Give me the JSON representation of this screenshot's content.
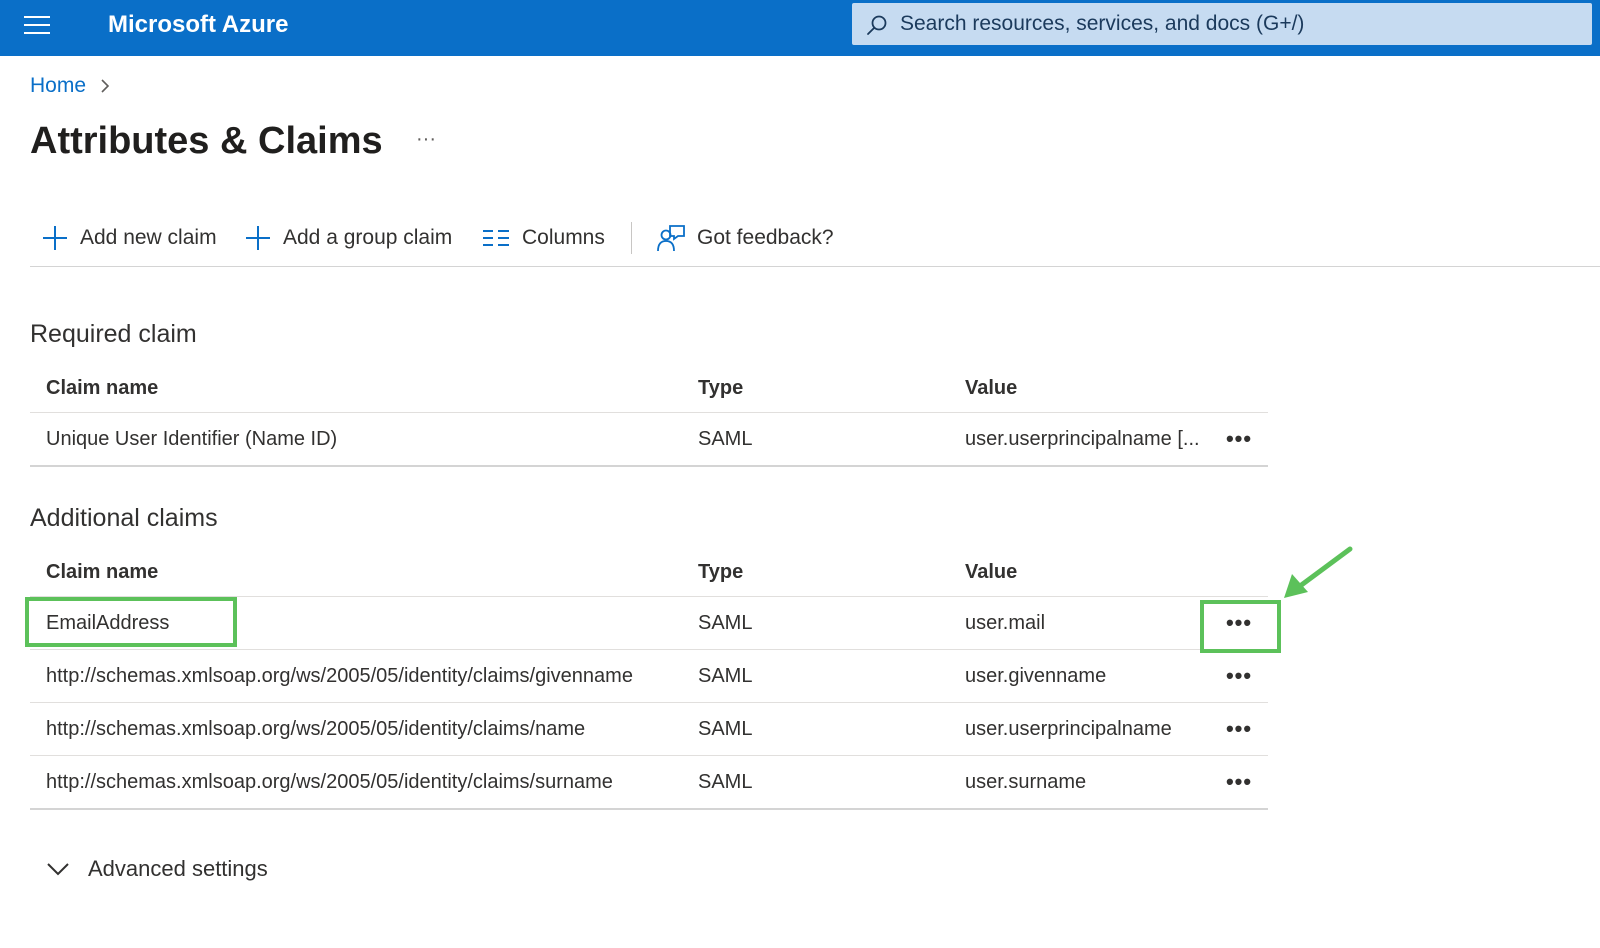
{
  "header": {
    "brand": "Microsoft Azure",
    "search_placeholder": "Search resources, services, and docs (G+/)",
    "bar_color": "#0a6fc8"
  },
  "breadcrumb": {
    "home": "Home"
  },
  "page": {
    "title": "Attributes & Claims",
    "more": "···"
  },
  "toolbar": {
    "add_claim": "Add new claim",
    "add_group_claim": "Add a group claim",
    "columns": "Columns",
    "feedback": "Got feedback?"
  },
  "required": {
    "title": "Required claim",
    "headers": {
      "name": "Claim name",
      "type": "Type",
      "value": "Value"
    },
    "rows": [
      {
        "name": "Unique User Identifier (Name ID)",
        "type": "SAML",
        "value": "user.userprincipalname [...",
        "more": "•••"
      }
    ]
  },
  "additional": {
    "title": "Additional claims",
    "headers": {
      "name": "Claim name",
      "type": "Type",
      "value": "Value"
    },
    "rows": [
      {
        "name": "EmailAddress",
        "type": "SAML",
        "value": "user.mail",
        "more": "•••"
      },
      {
        "name": "http://schemas.xmlsoap.org/ws/2005/05/identity/claims/givenname",
        "type": "SAML",
        "value": "user.givenname",
        "more": "•••"
      },
      {
        "name": "http://schemas.xmlsoap.org/ws/2005/05/identity/claims/name",
        "type": "SAML",
        "value": "user.userprincipalname",
        "more": "•••"
      },
      {
        "name": "http://schemas.xmlsoap.org/ws/2005/05/identity/claims/surname",
        "type": "SAML",
        "value": "user.surname",
        "more": "•••"
      }
    ]
  },
  "advanced": {
    "label": "Advanced settings"
  },
  "annotation": {
    "highlight_color": "#5cc15a"
  }
}
